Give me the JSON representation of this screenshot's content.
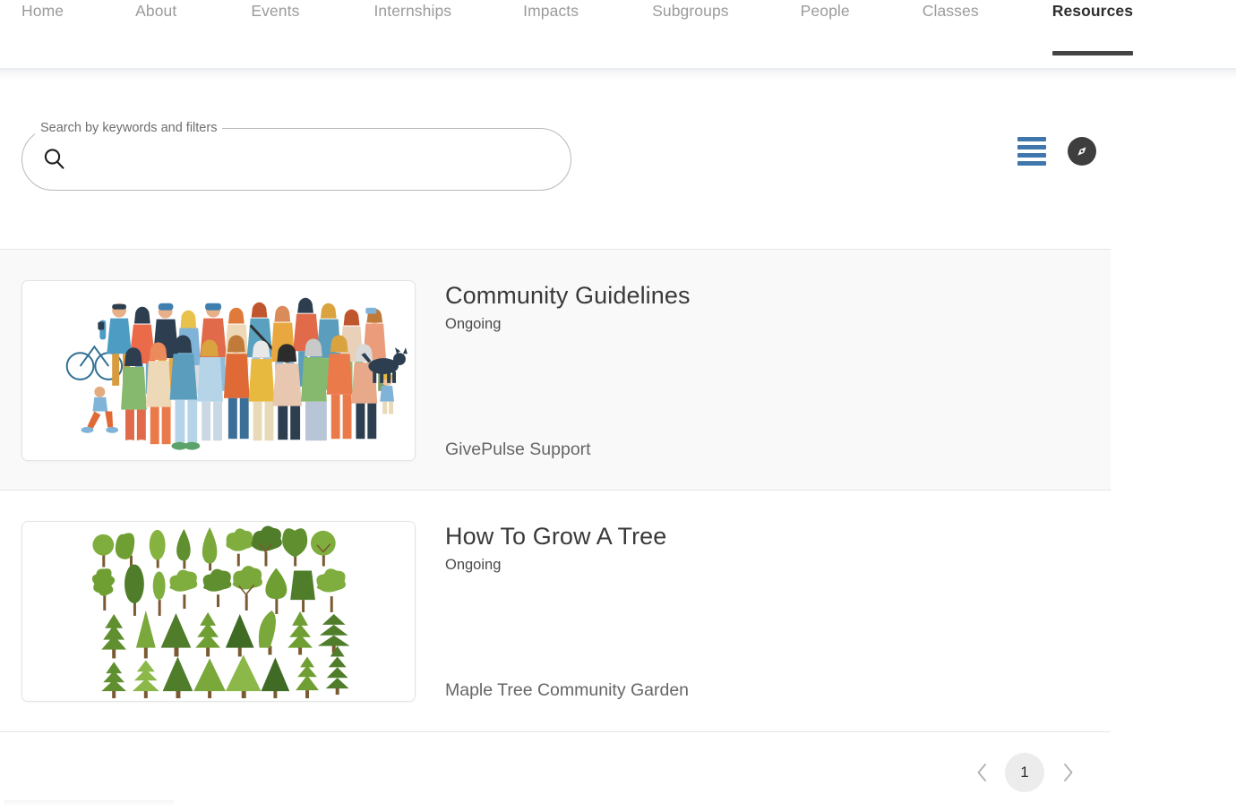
{
  "nav": {
    "items": [
      {
        "label": "Home",
        "active": false
      },
      {
        "label": "About",
        "active": false
      },
      {
        "label": "Events",
        "active": false
      },
      {
        "label": "Internships",
        "active": false
      },
      {
        "label": "Impacts",
        "active": false
      },
      {
        "label": "Subgroups",
        "active": false
      },
      {
        "label": "People",
        "active": false
      },
      {
        "label": "Classes",
        "active": false
      },
      {
        "label": "Resources",
        "active": true
      }
    ],
    "active_item": "Resources",
    "active_underline_color": "#444444",
    "inactive_color": "#9b9b9b",
    "active_color": "#2f2f2f"
  },
  "search": {
    "label": "Search by keywords and filters",
    "value": "",
    "placeholder": "",
    "icon": "search-icon"
  },
  "view_toggles": [
    {
      "name": "list-view-icon",
      "label": "List view",
      "color": "#3f76ac",
      "selected": true
    },
    {
      "name": "explore-view-icon",
      "label": "Explore view",
      "color": "#3e3e3e",
      "selected": false
    }
  ],
  "results": [
    {
      "title": "Community Guidelines",
      "schedule": "Ongoing",
      "owner": "GivePulse Support",
      "thumbnail": "crowd-of-people-illustration",
      "highlighted": true
    },
    {
      "title": "How To Grow A Tree",
      "schedule": "Ongoing",
      "owner": "Maple Tree Community Garden",
      "thumbnail": "grid-of-trees-illustration",
      "highlighted": false
    }
  ],
  "pagination": {
    "prev_label": "‹",
    "next_label": "›",
    "pages": [
      "1"
    ],
    "current_page": "1"
  }
}
